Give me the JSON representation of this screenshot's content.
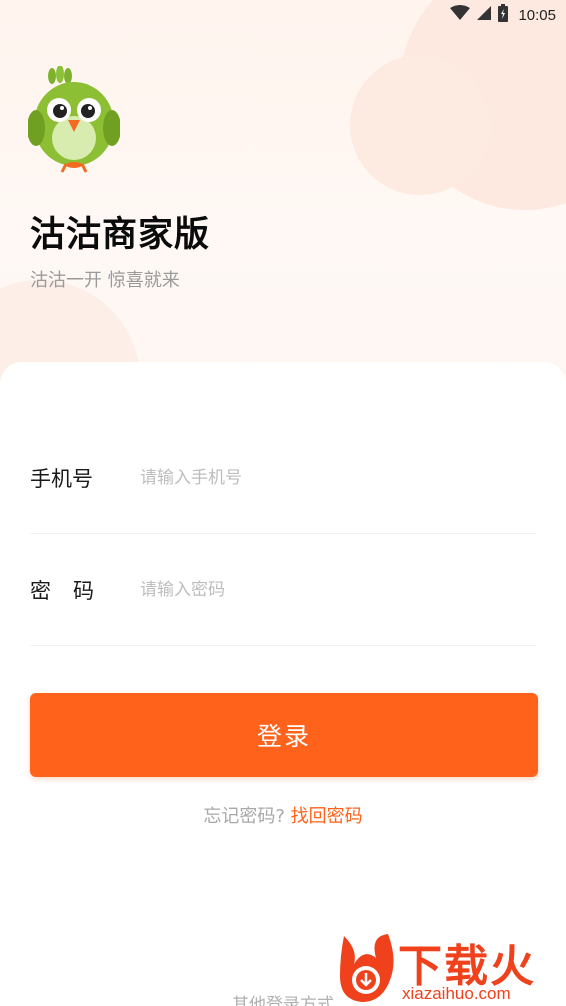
{
  "status_bar": {
    "time": "10:05",
    "icons": [
      "wifi-icon",
      "signal-icon",
      "battery-icon"
    ]
  },
  "brand": {
    "title": "沽沽商家版",
    "slogan": "沽沽一开 惊喜就来",
    "logo": "bird-mascot-icon"
  },
  "form": {
    "phone_label": "手机号",
    "phone_placeholder": "请输入手机号",
    "phone_value": "",
    "password_label": "密码",
    "password_placeholder": "请输入密码",
    "password_value": ""
  },
  "actions": {
    "login_label": "登录",
    "forgot_text": "忘记密码?",
    "forgot_link": "找回密码",
    "other_login": "其他登录方式"
  },
  "watermark": {
    "text": "下载火",
    "sub": "xiazaihuo.com"
  },
  "colors": {
    "accent": "#fe621b",
    "title": "#0b0b0b",
    "muted": "#9a9a9a"
  }
}
